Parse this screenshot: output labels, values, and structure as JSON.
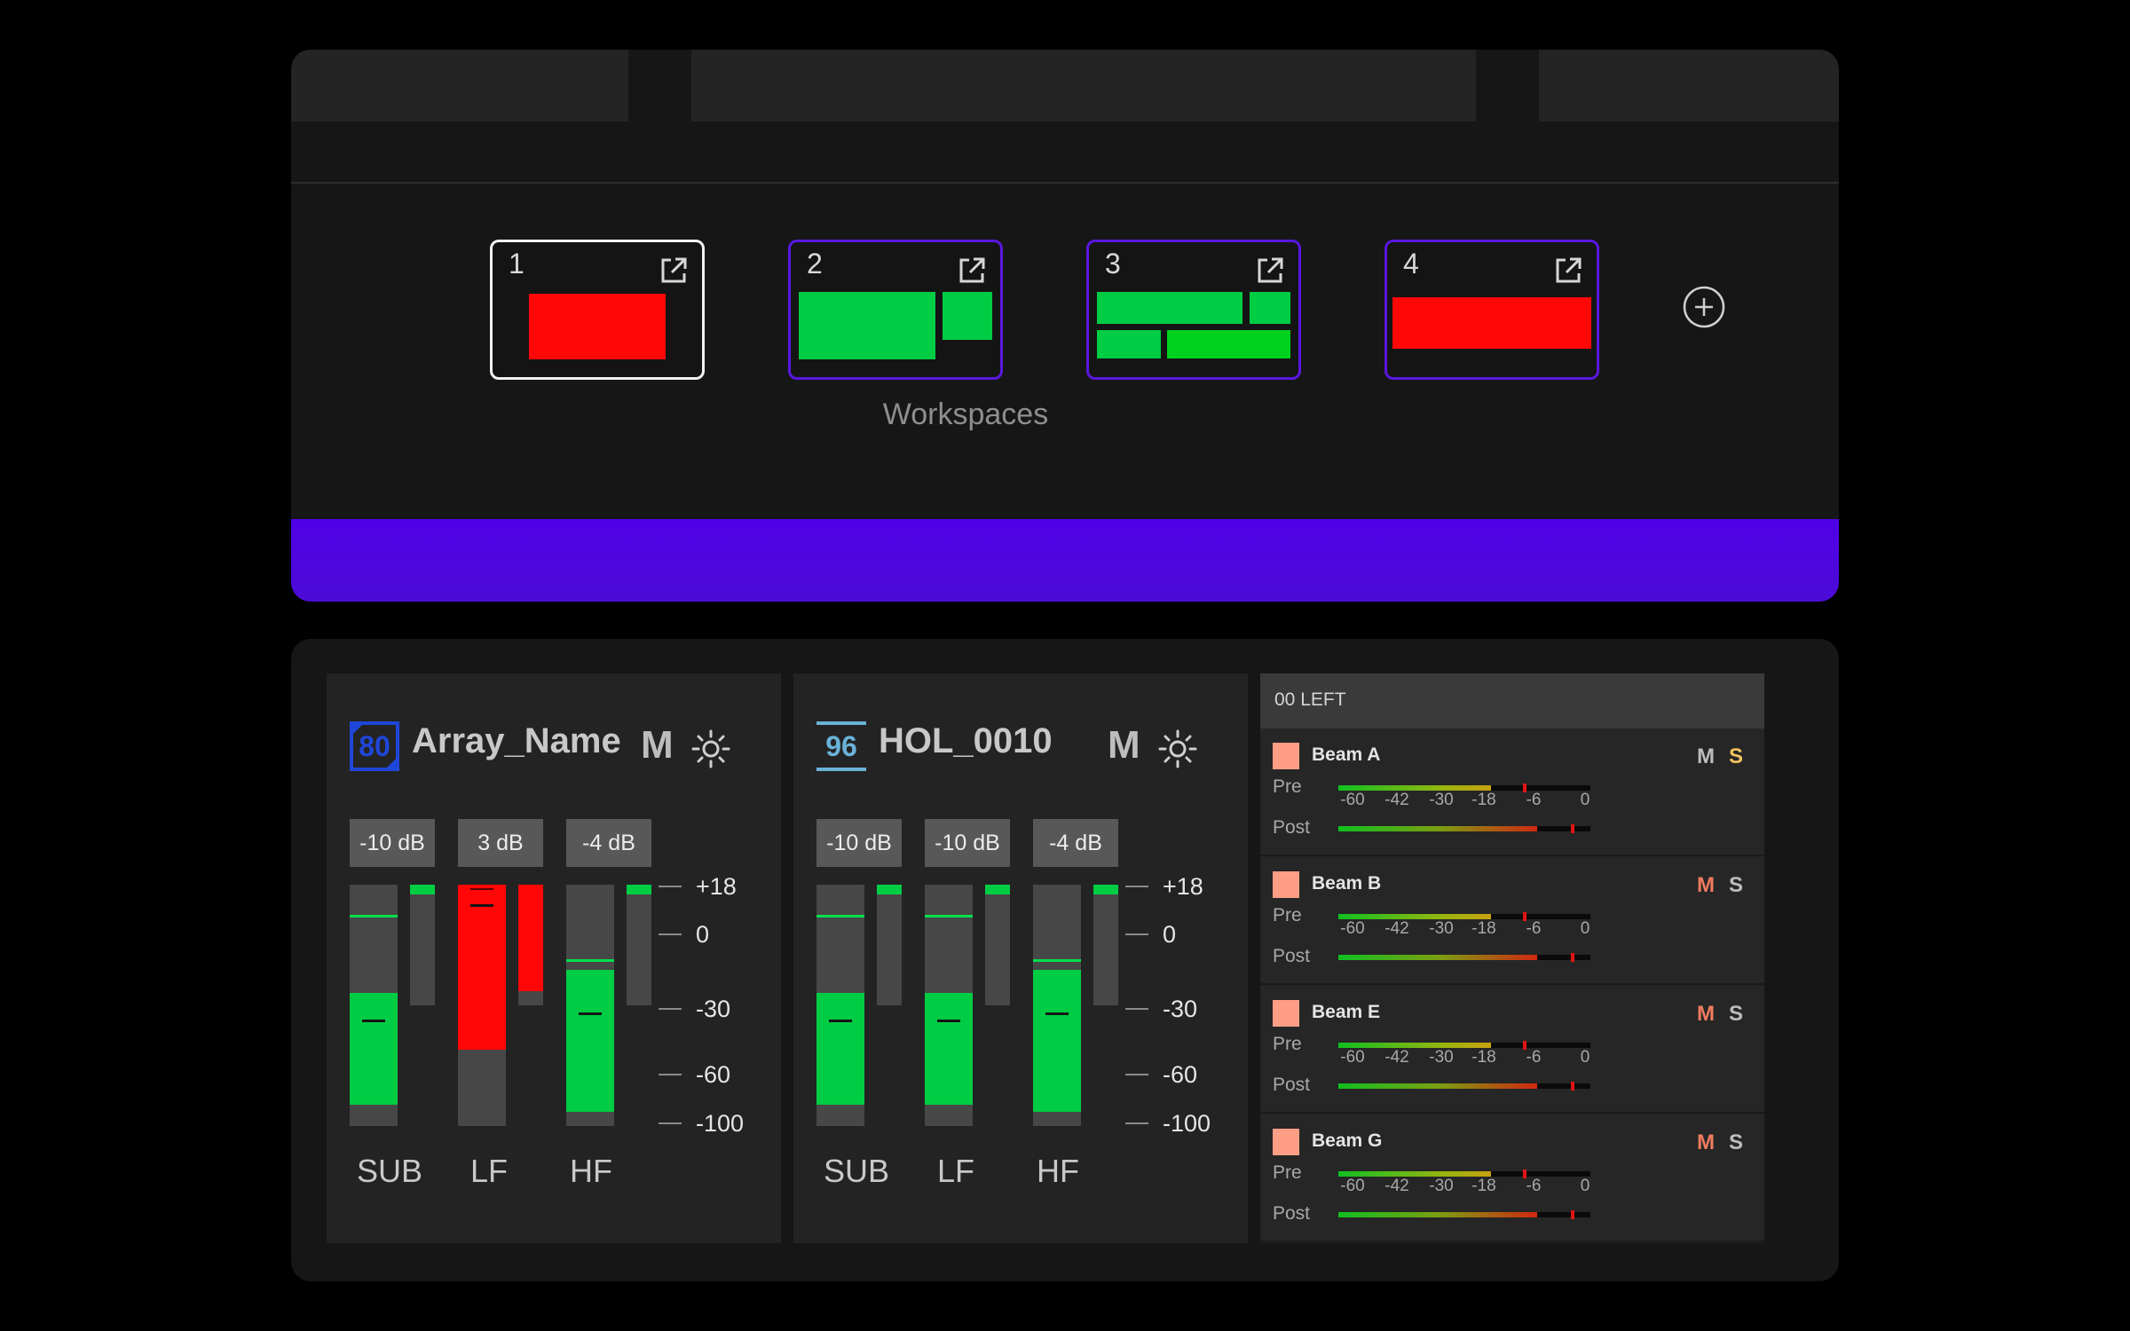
{
  "workspaces": {
    "title": "Workspaces",
    "cards": [
      {
        "number": "1",
        "active": true
      },
      {
        "number": "2",
        "active": false
      },
      {
        "number": "3",
        "active": false
      },
      {
        "number": "4",
        "active": false
      }
    ],
    "add_icon": "plus-circle-icon",
    "external_icon": "external-link-icon"
  },
  "colors": {
    "accent": "#5000e6",
    "meter_green": "#00cc44",
    "meter_red": "#ff0707",
    "beam_swatch": "#ff9e86",
    "mute_active": "#f07b5f",
    "solo_active": "#f0c45e"
  },
  "arrays": [
    {
      "badge": "80",
      "badge_color": "#1e46d8",
      "name": "Array_Name",
      "mute_label": "M",
      "settings_icon": "sun-icon",
      "bands": [
        {
          "label": "SUB",
          "gain": "-10 dB",
          "level_percent": 55,
          "color": "green"
        },
        {
          "label": "LF",
          "gain": "3 dB",
          "level_percent": 100,
          "color": "red"
        },
        {
          "label": "HF",
          "gain": "-4 dB",
          "level_percent": 63,
          "color": "green"
        }
      ],
      "scale": [
        "+18",
        "0",
        "-30",
        "-60",
        "-100"
      ]
    },
    {
      "badge": "96",
      "badge_color": "#6ab2d8",
      "name": "HOL_0010",
      "mute_label": "M",
      "settings_icon": "sun-icon",
      "bands": [
        {
          "label": "SUB",
          "gain": "-10 dB",
          "level_percent": 55,
          "color": "green"
        },
        {
          "label": "LF",
          "gain": "-10 dB",
          "level_percent": 55,
          "color": "green"
        },
        {
          "label": "HF",
          "gain": "-4 dB",
          "level_percent": 63,
          "color": "green"
        }
      ],
      "scale": [
        "+18",
        "0",
        "-30",
        "-60",
        "-100"
      ]
    }
  ],
  "beams": {
    "title": "00 LEFT",
    "pre_label": "Pre",
    "post_label": "Post",
    "scale": [
      "-60",
      "-42",
      "-30",
      "-18",
      "-6",
      "0"
    ],
    "rows": [
      {
        "name": "Beam A",
        "mute": "M",
        "solo": "S",
        "mute_active": false,
        "solo_active": true
      },
      {
        "name": "Beam B",
        "mute": "M",
        "solo": "S",
        "mute_active": true,
        "solo_active": false
      },
      {
        "name": "Beam E",
        "mute": "M",
        "solo": "S",
        "mute_active": true,
        "solo_active": false
      },
      {
        "name": "Beam G",
        "mute": "M",
        "solo": "S",
        "mute_active": true,
        "solo_active": false
      }
    ]
  }
}
